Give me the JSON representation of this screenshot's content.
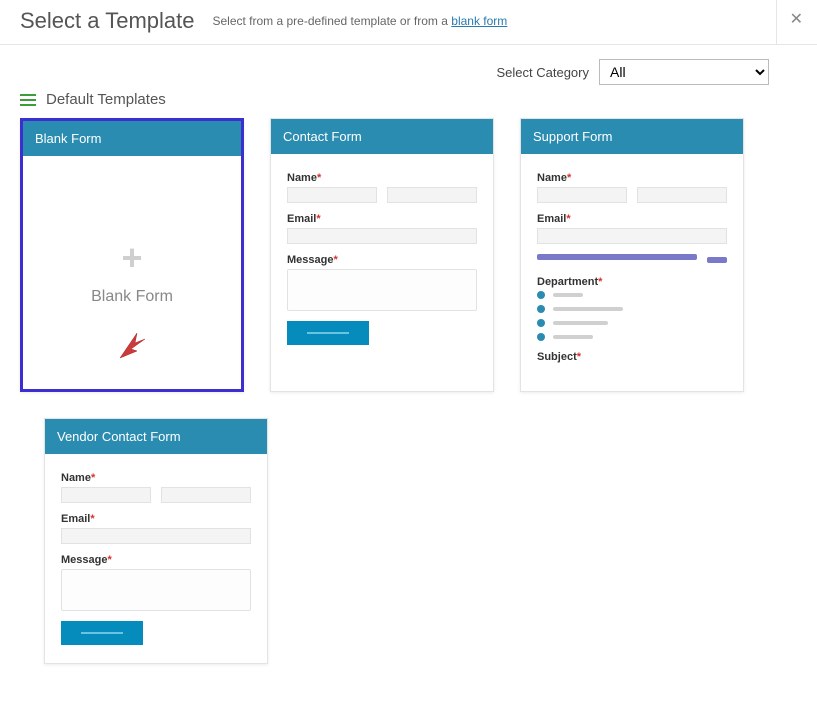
{
  "header": {
    "title": "Select a Template",
    "subtitle_prefix": "Select from a pre-defined template or from a ",
    "subtitle_link": "blank form"
  },
  "toolbar": {
    "category_label": "Select Category",
    "category_value": "All"
  },
  "section": {
    "title": "Default Templates"
  },
  "templates": {
    "blank": {
      "header": "Blank Form",
      "label": "Blank Form"
    },
    "contact": {
      "header": "Contact Form",
      "fields": {
        "name": "Name",
        "email": "Email",
        "message": "Message"
      }
    },
    "support": {
      "header": "Support Form",
      "fields": {
        "name": "Name",
        "email": "Email",
        "department": "Department",
        "subject": "Subject"
      }
    },
    "vendor": {
      "header": "Vendor Contact Form",
      "fields": {
        "name": "Name",
        "email": "Email",
        "message": "Message"
      }
    }
  },
  "asterisk": "*"
}
